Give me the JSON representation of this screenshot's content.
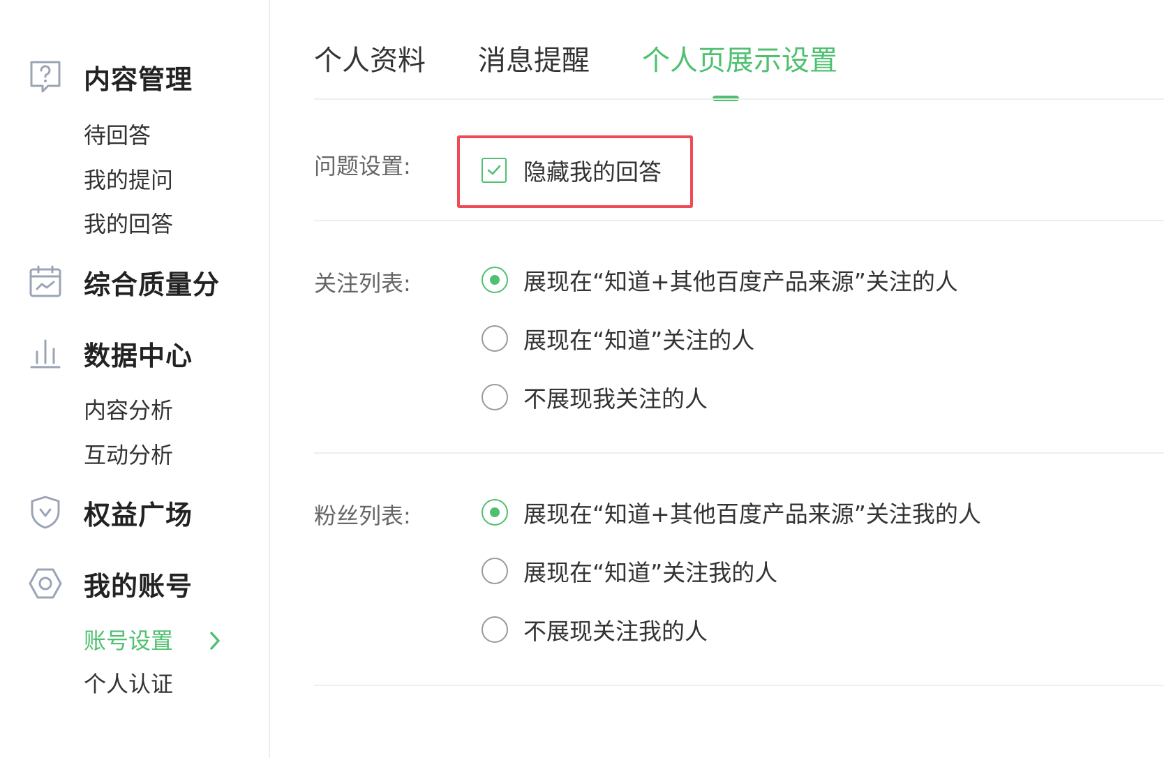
{
  "sidebar": {
    "content_mgmt": {
      "title": "内容管理",
      "icon": "question-icon",
      "items": [
        "待回答",
        "我的提问",
        "我的回答"
      ]
    },
    "quality": {
      "title": "综合质量分",
      "icon": "calendar-chart-icon"
    },
    "data_center": {
      "title": "数据中心",
      "icon": "bar-chart-icon",
      "items": [
        "内容分析",
        "互动分析"
      ]
    },
    "rights": {
      "title": "权益广场",
      "icon": "shield-icon"
    },
    "account": {
      "title": "我的账号",
      "icon": "hexagon-icon",
      "items": [
        "账号设置",
        "个人认证"
      ],
      "active_item": "账号设置"
    }
  },
  "tabs": [
    {
      "label": "个人资料",
      "active": false
    },
    {
      "label": "消息提醒",
      "active": false
    },
    {
      "label": "个人页展示设置",
      "active": true
    }
  ],
  "settings": {
    "question": {
      "label": "问题设置:",
      "checkbox_label": "隐藏我的回答",
      "checked": true
    },
    "follow_list": {
      "label": "关注列表:",
      "options": [
        "展现在“知道+其他百度产品来源”关注的人",
        "展现在“知道”关注的人",
        "不展现我关注的人"
      ],
      "selected_index": 0
    },
    "fans_list": {
      "label": "粉丝列表:",
      "options": [
        "展现在“知道+其他百度产品来源”关注我的人",
        "展现在“知道”关注我的人",
        "不展现关注我的人"
      ],
      "selected_index": 0
    }
  },
  "colors": {
    "accent": "#4fc06f",
    "highlight": "#ee4a57",
    "text": "#333333",
    "label": "#666666"
  }
}
